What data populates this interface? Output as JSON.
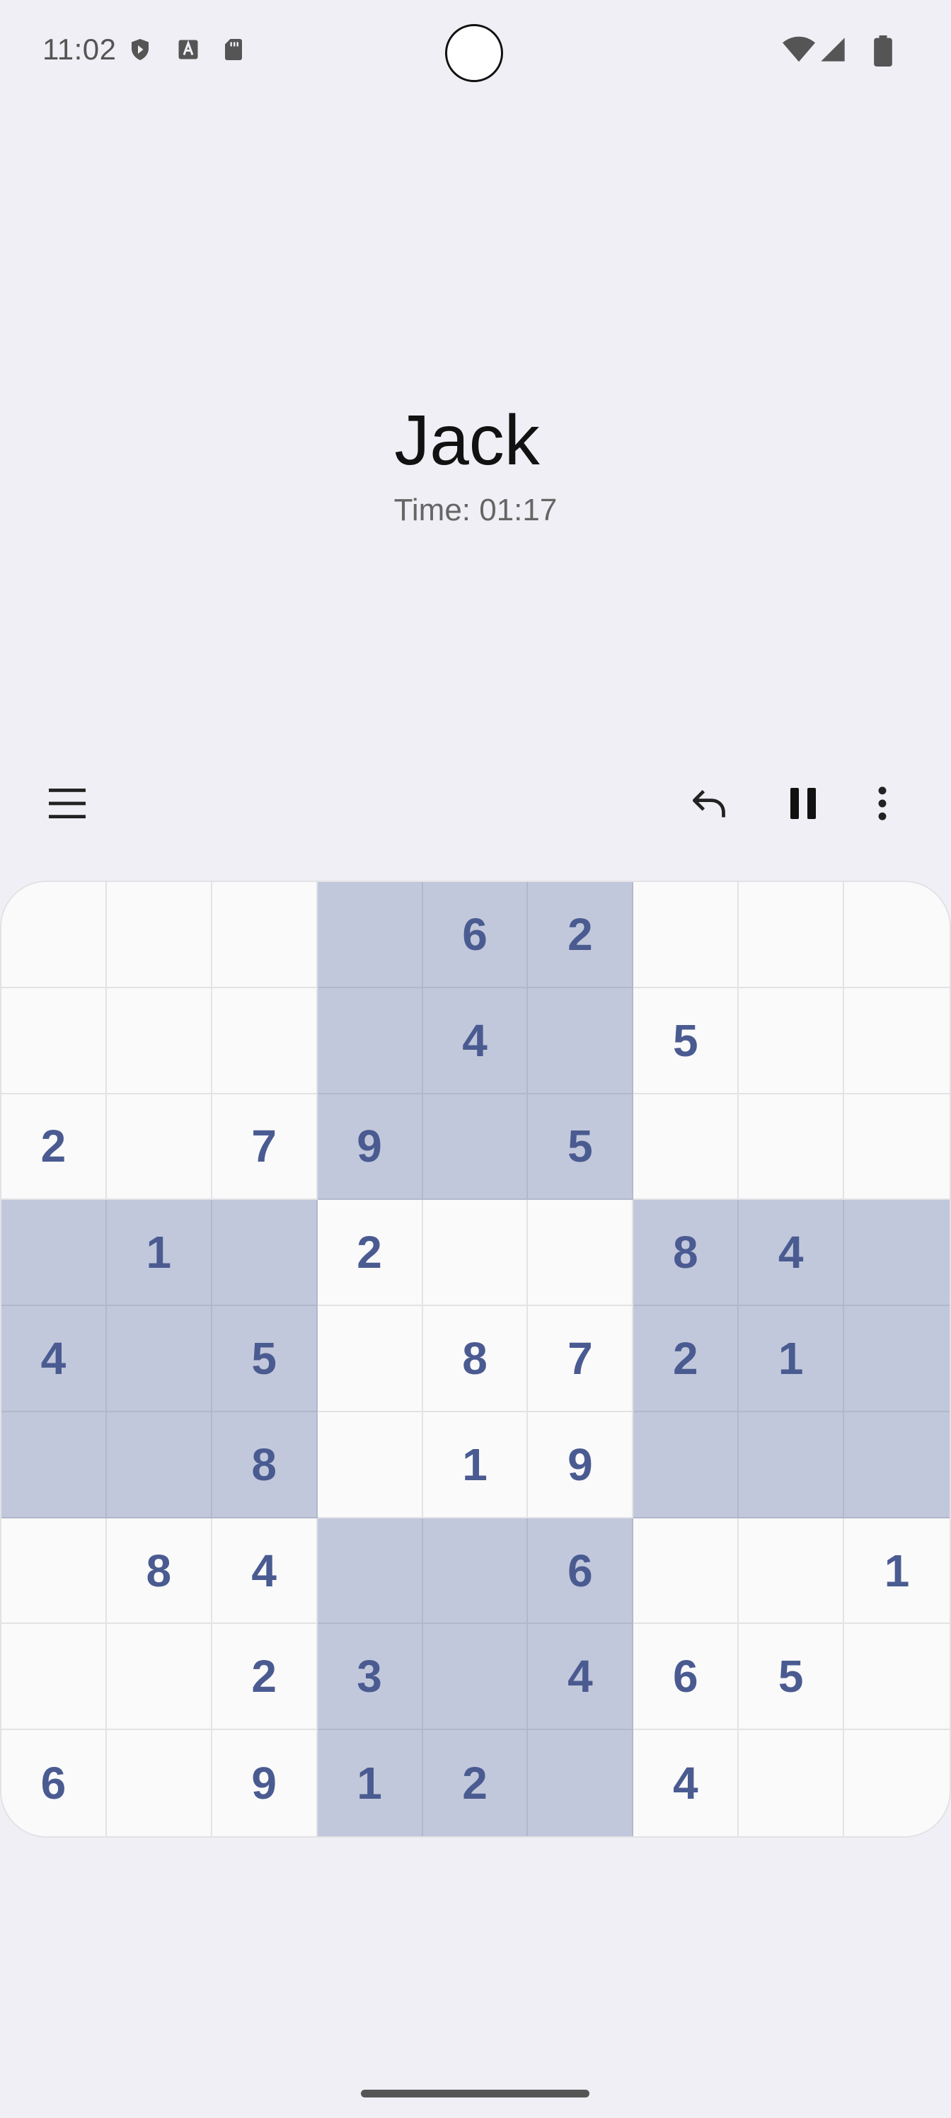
{
  "status_bar": {
    "time": "11:02",
    "left_icons": [
      "shield-icon",
      "font-icon",
      "sd-card-icon"
    ],
    "right_icons": [
      "wifi-icon",
      "signal-icon",
      "battery-icon"
    ]
  },
  "header": {
    "player_name": "Jack",
    "timer": "Time: 01:17"
  },
  "toolbar": {
    "menu_icon": "menu-icon",
    "undo_icon": "undo-icon",
    "pause_icon": "pause-icon",
    "more_icon": "more-vert-icon"
  },
  "colors": {
    "background": "#f0eff5",
    "digit": "#4a5b91",
    "highlight": "#c2c8db",
    "cell": "#fafafa"
  },
  "board": {
    "cells": [
      [
        "",
        "",
        "",
        "",
        "6",
        "2",
        "",
        "",
        ""
      ],
      [
        "",
        "",
        "",
        "",
        "4",
        "",
        "5",
        "",
        ""
      ],
      [
        "2",
        "",
        "7",
        "9",
        "",
        "5",
        "",
        "",
        ""
      ],
      [
        "",
        "1",
        "",
        "2",
        "",
        "",
        "8",
        "4",
        ""
      ],
      [
        "4",
        "",
        "5",
        "",
        "8",
        "7",
        "2",
        "1",
        ""
      ],
      [
        "",
        "",
        "8",
        "",
        "1",
        "9",
        "",
        "",
        ""
      ],
      [
        "",
        "8",
        "4",
        "",
        "",
        "6",
        "",
        "",
        "1"
      ],
      [
        "",
        "",
        "2",
        "3",
        "",
        "4",
        "6",
        "5",
        ""
      ],
      [
        "6",
        "",
        "9",
        "1",
        "2",
        "",
        "4",
        "",
        ""
      ]
    ],
    "highlighted": [
      [
        0,
        0,
        0,
        1,
        1,
        1,
        0,
        0,
        0
      ],
      [
        0,
        0,
        0,
        1,
        1,
        1,
        0,
        0,
        0
      ],
      [
        0,
        0,
        0,
        1,
        1,
        1,
        0,
        0,
        0
      ],
      [
        1,
        1,
        1,
        0,
        0,
        0,
        1,
        1,
        1
      ],
      [
        1,
        1,
        1,
        0,
        0,
        0,
        1,
        1,
        1
      ],
      [
        1,
        1,
        1,
        0,
        0,
        0,
        1,
        1,
        1
      ],
      [
        0,
        0,
        0,
        1,
        1,
        1,
        0,
        0,
        0
      ],
      [
        0,
        0,
        0,
        1,
        1,
        1,
        0,
        0,
        0
      ],
      [
        0,
        0,
        0,
        1,
        1,
        1,
        0,
        0,
        0
      ]
    ]
  }
}
